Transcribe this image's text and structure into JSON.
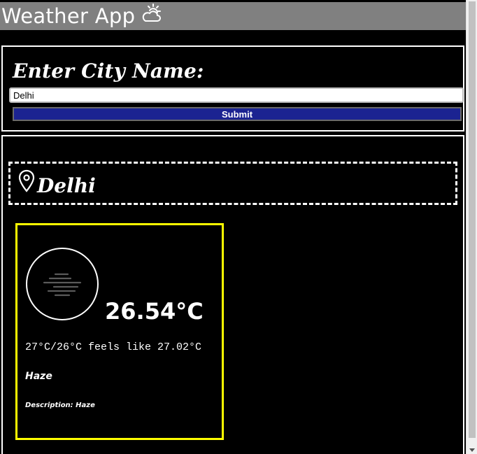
{
  "header": {
    "title": "Weather App",
    "icon": "partly-cloudy-icon",
    "background": "#808080"
  },
  "search": {
    "label": "Enter City Name:",
    "input_value": "Delhi",
    "submit_label": "Submit",
    "submit_color": "#1b2391"
  },
  "result": {
    "location": "Delhi",
    "location_icon": "map-pin-icon",
    "card": {
      "border_color": "#ffff00",
      "weather_icon": "haze-icon",
      "temperature": "26.54°C",
      "range_text": "27°C/26°C feels like 27.02°C",
      "condition": "Haze",
      "description": "Description: Haze"
    }
  }
}
